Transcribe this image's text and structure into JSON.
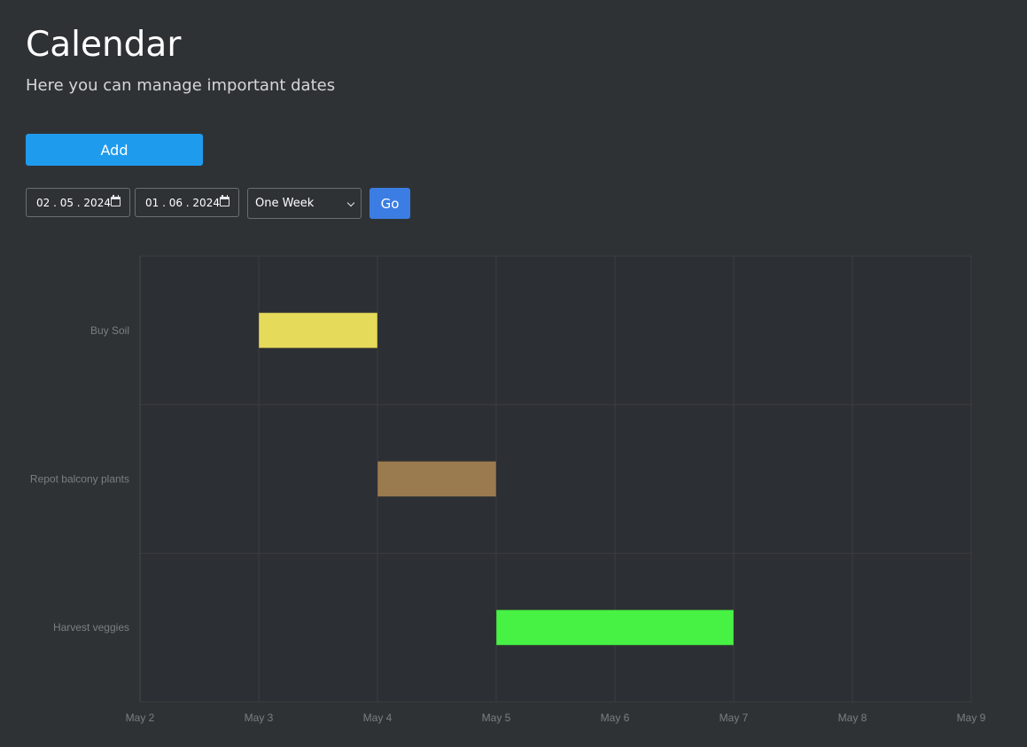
{
  "header": {
    "title": "Calendar",
    "subtitle": "Here you can manage important dates"
  },
  "toolbar": {
    "add_label": "Add"
  },
  "controls": {
    "start_date": "02.05.2024",
    "end_date": "01.06.2024",
    "range_option": "One Week",
    "go_label": "Go"
  },
  "colors": {
    "background": "#2f3235",
    "add_button": "#1f9bee",
    "go_button": "#3b7de2"
  },
  "chart_data": {
    "type": "gantt",
    "x_ticks": [
      "May 2",
      "May 3",
      "May 4",
      "May 5",
      "May 6",
      "May 7",
      "May 8",
      "May 9"
    ],
    "xlim": [
      "May 2",
      "May 9"
    ],
    "grid": true,
    "tasks": [
      {
        "name": "Buy Soil",
        "start": "May 3",
        "end": "May 4",
        "color": "#e5da5a"
      },
      {
        "name": "Repot balcony plants",
        "start": "May 4",
        "end": "May 5",
        "color": "#9a7a4f"
      },
      {
        "name": "Harvest veggies",
        "start": "May 5",
        "end": "May 7",
        "color": "#47f245"
      }
    ]
  }
}
